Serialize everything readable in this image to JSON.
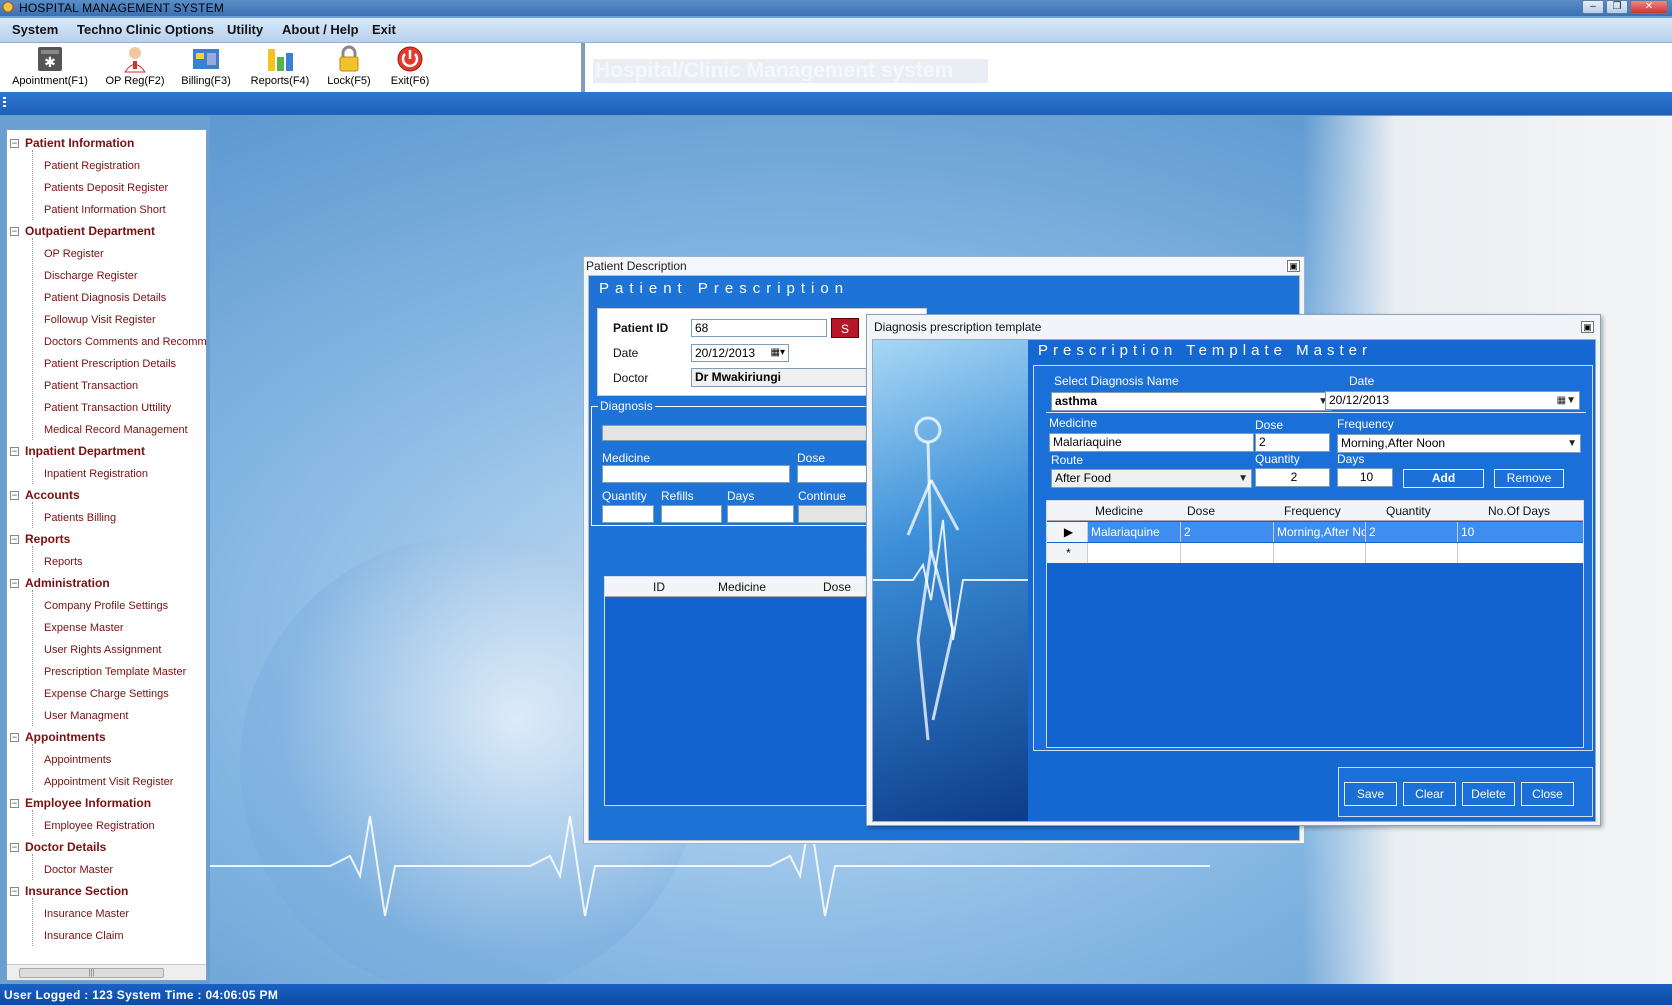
{
  "window": {
    "title": "HOSPITAL MANAGEMENT SYSTEM"
  },
  "menu": [
    "System",
    "Techno Clinic Options",
    "Utility",
    "About / Help",
    "Exit"
  ],
  "toolbar": [
    {
      "label": "Apointment(F1)",
      "icon": "appointment-icon"
    },
    {
      "label": "OP Reg(F2)",
      "icon": "doctor-icon"
    },
    {
      "label": "Billing(F3)",
      "icon": "billing-icon"
    },
    {
      "label": "Reports(F4)",
      "icon": "reports-chart-icon"
    },
    {
      "label": "Lock(F5)",
      "icon": "lock-icon"
    },
    {
      "label": "Exit(F6)",
      "icon": "power-icon"
    }
  ],
  "banner": "Hospital/Clinic Management system",
  "tree": [
    {
      "group": "Patient Information",
      "items": [
        "Patient Registration",
        "Patients Deposit Register",
        "Patient Information Short"
      ]
    },
    {
      "group": "Outpatient Department",
      "items": [
        "OP Register",
        "Discharge Register",
        "Patient Diagnosis Details",
        "Followup Visit Register",
        "Doctors Comments and Recommer",
        "Patient Prescription Details",
        "Patient Transaction",
        "Patient Transaction Uttility",
        "Medical Record Management"
      ]
    },
    {
      "group": "Inpatient Department",
      "items": [
        "Inpatient Registration"
      ]
    },
    {
      "group": "Accounts",
      "items": [
        "Patients Billing"
      ]
    },
    {
      "group": "Reports",
      "items": [
        "Reports"
      ]
    },
    {
      "group": "Administration",
      "items": [
        "Company Profile Settings",
        "Expense Master",
        "User Rights Assignment",
        "Prescription Template Master",
        "Expense Charge Settings",
        "User Managment"
      ]
    },
    {
      "group": "Appointments",
      "items": [
        "Appointments",
        "Appointment Visit Register"
      ]
    },
    {
      "group": "Employee Information",
      "items": [
        "Employee Registration"
      ]
    },
    {
      "group": "Doctor Details",
      "items": [
        "Doctor Master"
      ]
    },
    {
      "group": "Insurance Section",
      "items": [
        "Insurance Master",
        "Insurance Claim"
      ]
    }
  ],
  "patient_description": {
    "window_title": "Patient Description",
    "header": "Patient  Prescription",
    "patient_id_label": "Patient ID",
    "patient_id_value": "68",
    "search_button": "S",
    "date_label": "Date",
    "date_value": "20/12/2013",
    "doctor_label": "Doctor",
    "doctor_value": "Dr Mwakiriungi",
    "diagnosis_label": "Diagnosis",
    "medicine_label": "Medicine",
    "dose_label": "Dose",
    "quantity_label": "Quantity",
    "refills_label": "Refills",
    "days_label": "Days",
    "continue_label": "Continue",
    "grid_headers": [
      "ID",
      "Medicine",
      "Dose"
    ]
  },
  "template_window": {
    "window_title": "Diagnosis prescription  template",
    "header": "Prescription Template Master",
    "diagnosis_name_label": "Select Diagnosis Name",
    "diagnosis_name_value": "asthma",
    "date_label": "Date",
    "date_value": "20/12/2013",
    "medicine_label": "Medicine",
    "medicine_value": "Malariaquine",
    "dose_label": "Dose",
    "dose_value": "2",
    "frequency_label": "Frequency",
    "frequency_value": "Morning,After Noon",
    "route_label": "Route",
    "route_value": "After Food",
    "quantity_label": "Quantity",
    "quantity_value": "2",
    "days_label": "Days",
    "days_value": "10",
    "add_button": "Add",
    "remove_button": "Remove",
    "grid": {
      "headers": [
        "Medicine",
        "Dose",
        "Frequency",
        "Quantity",
        "No.Of Days"
      ],
      "rows": [
        [
          "Malariaquine",
          "2",
          "Morning,After No...",
          "2",
          "10"
        ]
      ],
      "new_row_marker": "*"
    },
    "buttons": [
      "Save",
      "Clear",
      "Delete",
      "Close"
    ]
  },
  "status": "User Logged : 123  System Time : 04:06:05 PM"
}
